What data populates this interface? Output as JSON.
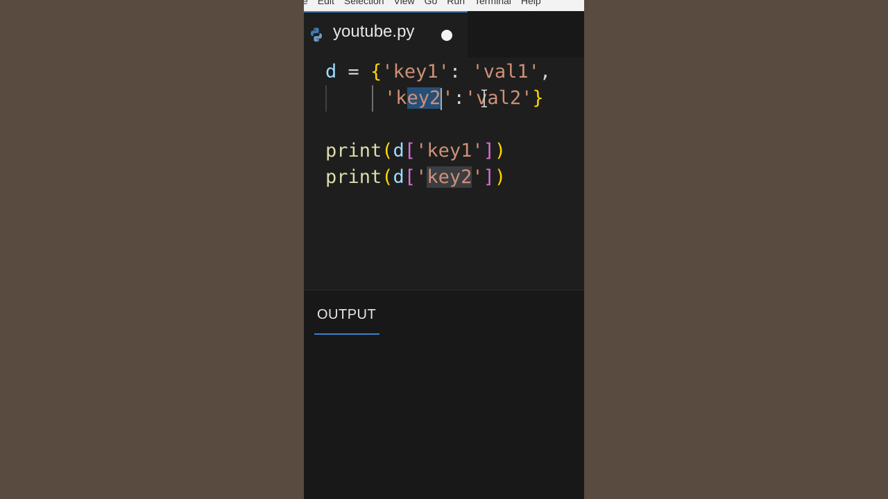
{
  "menubar": {
    "items": [
      "e",
      "Edit",
      "Selection",
      "View",
      "Go",
      "Run",
      "Terminal",
      "Help"
    ]
  },
  "tab": {
    "title": "youtube.py",
    "icon": "python-icon",
    "modified": true
  },
  "editor": {
    "line1": {
      "var": "d",
      "eq": " = ",
      "open": "{",
      "k1": "'key1'",
      "colon1": ": ",
      "v1": "'val1'",
      "comma": ","
    },
    "line2": {
      "q1": "'",
      "k2a": "k",
      "k2sel": "ey2",
      "q2": "'",
      "colon2": ":",
      "v2": "'val2'",
      "close": "}"
    },
    "line4": {
      "fn": "print",
      "p1": "(",
      "var": "d",
      "b1": "[",
      "s": "'key1'",
      "b2": "]",
      "p2": ")"
    },
    "line5": {
      "fn": "print",
      "p1": "(",
      "var": "d",
      "b1": "[",
      "q1": "'",
      "s": "key2",
      "q2": "'",
      "b2": "]",
      "p2": ")"
    }
  },
  "panel": {
    "tab_label": "OUTPUT"
  },
  "colors": {
    "accent": "#3c7fd1",
    "selection": "#264f78",
    "string": "#ce9178",
    "variable": "#9cdcfe",
    "function": "#dcdcaa",
    "bracket_gold": "#ffd700",
    "bracket_violet": "#da70d6"
  }
}
